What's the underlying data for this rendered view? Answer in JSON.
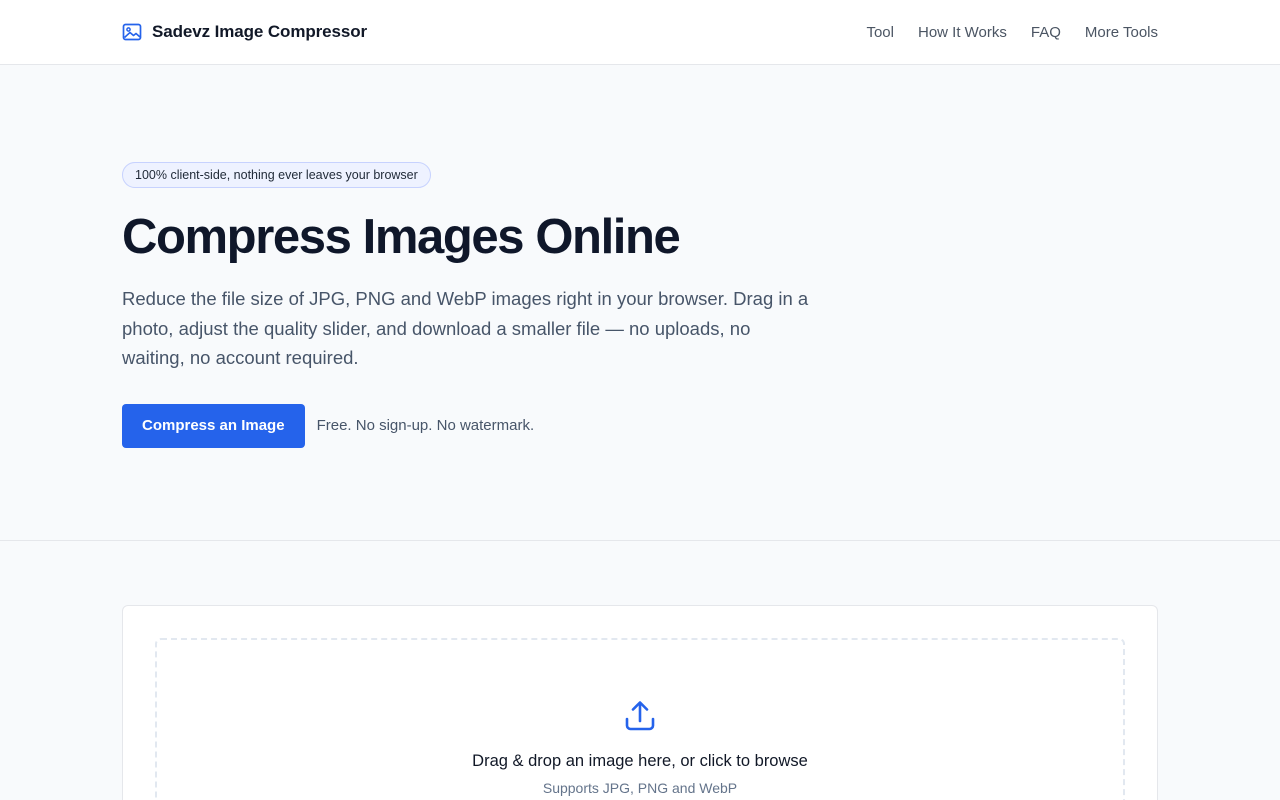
{
  "header": {
    "brand": "Sadevz Image Compressor",
    "nav": [
      "Tool",
      "How It Works",
      "FAQ",
      "More Tools"
    ]
  },
  "hero": {
    "badge": "100% client-side, nothing ever leaves your browser",
    "title": "Compress Images Online",
    "description": "Reduce the file size of JPG, PNG and WebP images right in your browser. Drag in a photo, adjust the quality slider, and download a smaller file — no uploads, no waiting, no account required.",
    "cta_label": "Compress an Image",
    "cta_note": "Free. No sign-up. No watermark."
  },
  "tool": {
    "drop_title": "Drag & drop an image here, or click to browse",
    "drop_subtitle": "Supports JPG, PNG and WebP"
  },
  "colors": {
    "accent": "#2563eb",
    "text": "#0f172a",
    "muted": "#475569",
    "background": "#f8fafc"
  },
  "icons": {
    "brand": "image-icon",
    "upload": "upload-icon"
  }
}
